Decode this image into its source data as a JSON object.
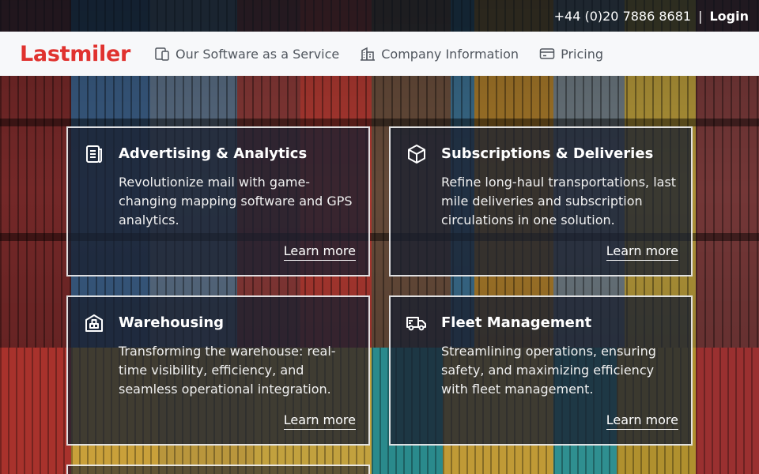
{
  "topbar": {
    "phone": "+44 (0)20 7886 8681",
    "separator": "|",
    "login": "Login"
  },
  "brand": {
    "name": "Lastmiler",
    "color": "#e0322f"
  },
  "nav": {
    "items": [
      {
        "label": "Our Software as a Service",
        "icon": "devices-icon"
      },
      {
        "label": "Company Information",
        "icon": "building-icon"
      },
      {
        "label": "Pricing",
        "icon": "card-icon"
      }
    ]
  },
  "cards": [
    {
      "title": "Advertising & Analytics",
      "text": "Revolutionize mail with game-changing mapping software and GPS analytics.",
      "link": "Learn more",
      "icon": "document-icon"
    },
    {
      "title": "Subscriptions & Deliveries",
      "text": "Refine long-haul transportations, last mile deliveries and subscription circulations in one solution.",
      "link": "Learn more",
      "icon": "box-icon"
    },
    {
      "title": "Warehousing",
      "text": "Transforming the warehouse: real-time visibility, efficiency, and seamless operational integration.",
      "link": "Learn more",
      "icon": "warehouse-icon"
    },
    {
      "title": "Fleet Management",
      "text": "Streamlining operations, ensuring safety, and maximizing efficiency with fleet management.",
      "link": "Learn more",
      "icon": "truck-icon"
    }
  ]
}
